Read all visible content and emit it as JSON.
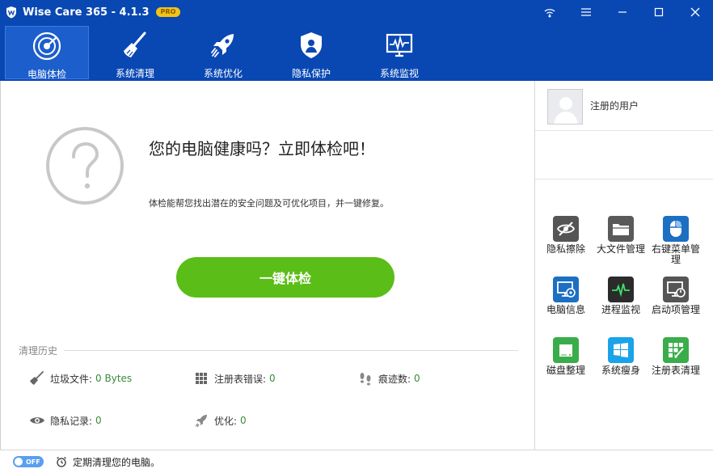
{
  "titlebar": {
    "title": "Wise Care 365 - 4.1.3",
    "badge": "PRO",
    "icons": [
      "wifi-icon",
      "menu-icon",
      "minimize-icon",
      "maximize-icon",
      "close-icon"
    ]
  },
  "nav": {
    "items": [
      {
        "label": "电脑体检",
        "icon": "radar-icon",
        "active": true
      },
      {
        "label": "系统清理",
        "icon": "broom-icon",
        "active": false
      },
      {
        "label": "系统优化",
        "icon": "rocket-icon",
        "active": false
      },
      {
        "label": "隐私保护",
        "icon": "shield-icon",
        "active": false
      },
      {
        "label": "系统监视",
        "icon": "monitor-icon",
        "active": false
      }
    ]
  },
  "main": {
    "headline": "您的电脑健康吗？立即体检吧！",
    "subline": "体检能帮您找出潜在的安全问题及可优化项目，并一键修复。",
    "scan_button": "一键体检",
    "history_title": "清理历史",
    "history": [
      {
        "label": "垃圾文件:",
        "value": "0 Bytes",
        "icon": "broom-icon"
      },
      {
        "label": "注册表错误:",
        "value": "0",
        "icon": "grid-icon"
      },
      {
        "label": "痕迹数:",
        "value": "0",
        "icon": "footprint-icon"
      },
      {
        "label": "隐私记录:",
        "value": "0",
        "icon": "eye-icon"
      },
      {
        "label": "优化:",
        "value": "0",
        "icon": "rocket-icon"
      }
    ]
  },
  "sidebar": {
    "user_name": "注册的用户",
    "tools": [
      {
        "label": "隐私擦除",
        "icon": "eye-slash-icon",
        "color": "#555555"
      },
      {
        "label": "大文件管理",
        "icon": "folder-icon",
        "color": "#5a5a5a"
      },
      {
        "label": "右键菜单管理",
        "icon": "mouse-icon",
        "color": "#1d6fc2"
      },
      {
        "label": "电脑信息",
        "icon": "computer-info-icon",
        "color": "#1d6fc2"
      },
      {
        "label": "进程监视",
        "icon": "pulse-icon",
        "color": "#2b2b2b"
      },
      {
        "label": "启动项管理",
        "icon": "startup-icon",
        "color": "#555555"
      },
      {
        "label": "磁盘整理",
        "icon": "disk-icon",
        "color": "#3aad4a"
      },
      {
        "label": "系统瘦身",
        "icon": "windows-icon",
        "color": "#1aa3e8"
      },
      {
        "label": "注册表清理",
        "icon": "registry-icon",
        "color": "#3aad4a"
      }
    ]
  },
  "statusbar": {
    "toggle_label": "OFF",
    "text": "定期清理您的电脑。"
  },
  "colors": {
    "brand_blue": "#0948b3",
    "scan_green": "#5bbd17",
    "value_green": "#3a8a3a"
  }
}
